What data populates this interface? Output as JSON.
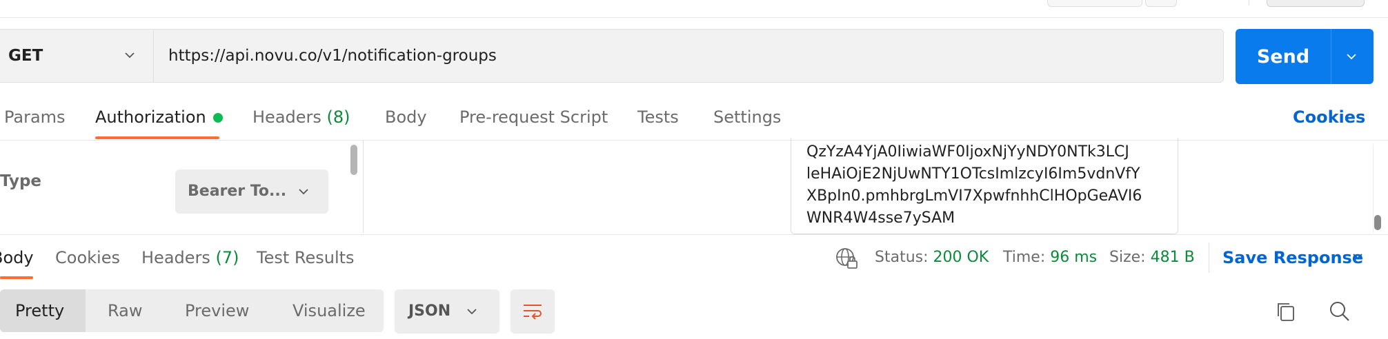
{
  "request": {
    "method": "GET",
    "url": "https://api.novu.co/v1/notification-groups",
    "send_label": "Send"
  },
  "request_tabs": {
    "params": "Params",
    "authorization": "Authorization",
    "headers": "Headers",
    "headers_count": "(8)",
    "body": "Body",
    "pre_request": "Pre-request Script",
    "tests": "Tests",
    "settings": "Settings",
    "cookies": "Cookies"
  },
  "auth": {
    "type_label": "Type",
    "type_value": "Bearer To...",
    "token_lines": [
      "QzYzA4YjA0IiwiaWF0IjoxNjYyNDY0NTk3LCJ",
      "leHAiOjE2NjUwNTY1OTcsImlzcyI6Im5vdnVfY",
      "XBpIn0.pmhbrgLmVI7XpwfnhhClHOpGeAVI6",
      "WNR4W4sse7ySAM"
    ]
  },
  "response_tabs": {
    "body": "Body",
    "cookies": "Cookies",
    "headers": "Headers",
    "headers_count": "(7)",
    "test_results": "Test Results"
  },
  "response_status": {
    "status_label": "Status:",
    "status_value": "200 OK",
    "time_label": "Time:",
    "time_value": "96 ms",
    "size_label": "Size:",
    "size_value": "481 B",
    "save_response": "Save Response"
  },
  "view_modes": {
    "pretty": "Pretty",
    "raw": "Raw",
    "preview": "Preview",
    "visualize": "Visualize",
    "format": "JSON"
  },
  "colors": {
    "accent": "#097bed",
    "tab_underline": "#ff6c37",
    "success": "#0b8a3a",
    "link": "#0265d2"
  }
}
